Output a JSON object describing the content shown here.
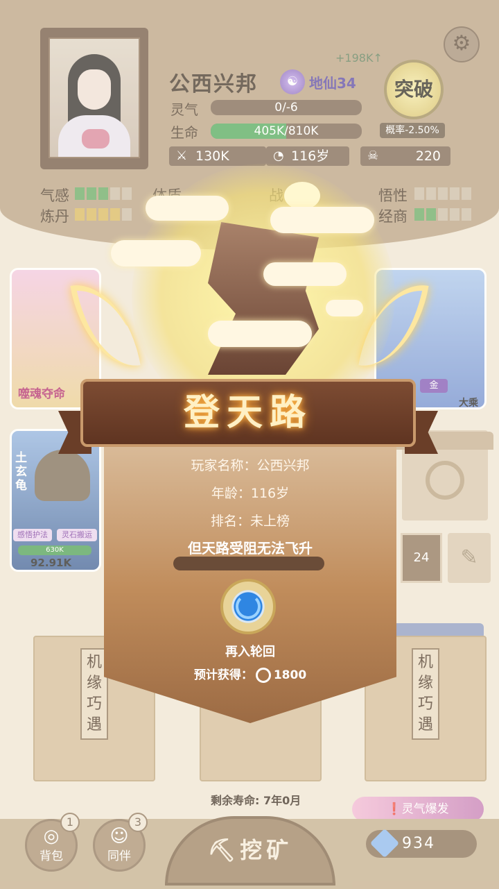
{
  "header": {
    "player_name": "公西兴邦",
    "realm": "地仙34",
    "power_gain": "+198K↑",
    "spirit_label": "灵气",
    "spirit_value": "0/-6",
    "life_label": "生命",
    "life_value": "405K/810K",
    "life_fraction": 0.5,
    "breakthrough_label": "突破",
    "probability": "概率-2.50%",
    "combat_power": "130K",
    "age": "116岁",
    "kills": "220"
  },
  "attributes": [
    {
      "label": "气感",
      "filled": 3,
      "color": "green"
    },
    {
      "label": "体质",
      "filled": 0,
      "color": "green"
    },
    {
      "label": "战",
      "filled": 0,
      "color": "green"
    },
    {
      "label": "悟性",
      "filled": 0,
      "color": "green"
    },
    {
      "label": "炼丹",
      "filled": 4,
      "color": "yellow"
    },
    {
      "label": "经商",
      "filled": 2,
      "color": "green"
    }
  ],
  "cards": {
    "card1_name": "噬魂夺命",
    "blue_badge": "金",
    "blue_label": "大乘"
  },
  "pet": {
    "name": "土玄龟",
    "tag1": "感悟护法",
    "tag2": "灵石搬运",
    "hp": "630K",
    "power": "92.91K"
  },
  "side": {
    "count": "24"
  },
  "envelopes": {
    "left_text": "机缘巧遇",
    "right_text": "机缘巧遇"
  },
  "footer": {
    "remaining_life": "剩余寿命: 7年0月",
    "spirit_burst": "灵气爆发",
    "bag_label": "背包",
    "bag_badge": "1",
    "partner_label": "同伴",
    "partner_badge": "3",
    "mine_label": "挖矿",
    "gems": "934"
  },
  "dialog": {
    "title": "登天路",
    "player_line": "玩家名称：公西兴邦",
    "age_line": "年龄：116岁",
    "rank_line": "排名：未上榜",
    "message": "但天路受阻无法飞升",
    "rebirth_label": "再入轮回",
    "reward_prefix": "预计获得：",
    "reward_value": "1800"
  }
}
